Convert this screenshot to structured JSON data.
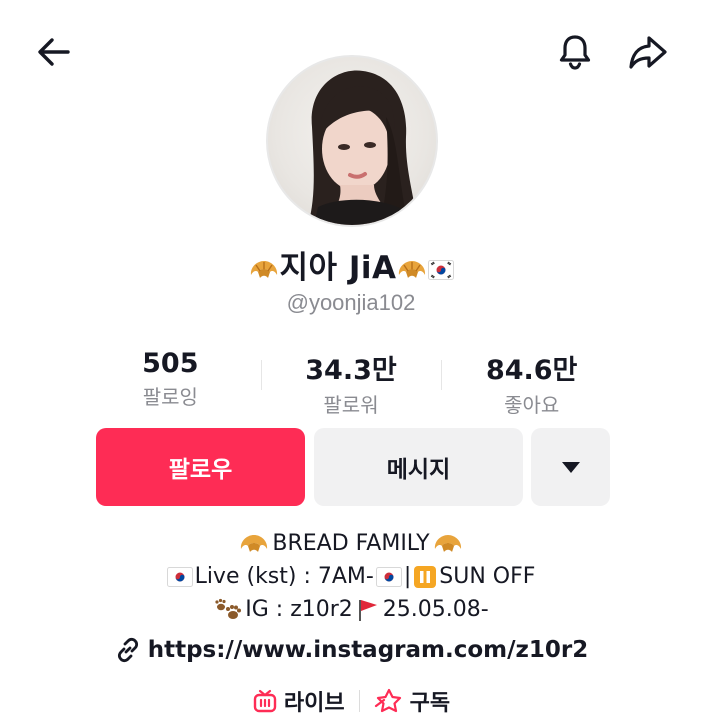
{
  "header": {
    "back_icon": "arrow-left-icon",
    "bell_icon": "bell-icon",
    "share_icon": "share-arrow-icon"
  },
  "profile": {
    "name_text": "지아 JiA",
    "handle": "@yoonjia102"
  },
  "stats": [
    {
      "value": "505",
      "label": "팔로잉"
    },
    {
      "value": "34.3만",
      "label": "팔로워"
    },
    {
      "value": "84.6만",
      "label": "좋아요"
    }
  ],
  "actions": {
    "follow_label": "팔로우",
    "message_label": "메시지",
    "more_icon": "caret-down-icon"
  },
  "bio": {
    "line1": "BREAD FAMILY",
    "line2_a": "Live (kst) : 7AM-",
    "line2_b": "|",
    "line2_c": "SUN OFF",
    "line3_a": "IG : z10r2",
    "line3_b": "25.05.08-"
  },
  "link": {
    "url": "https://www.instagram.com/z10r2"
  },
  "bottom": {
    "live_label": "라이브",
    "subscribe_label": "구독"
  },
  "colors": {
    "accent": "#fe2c55",
    "secondary_button": "#f1f1f2",
    "muted_text": "#8a8b91"
  }
}
